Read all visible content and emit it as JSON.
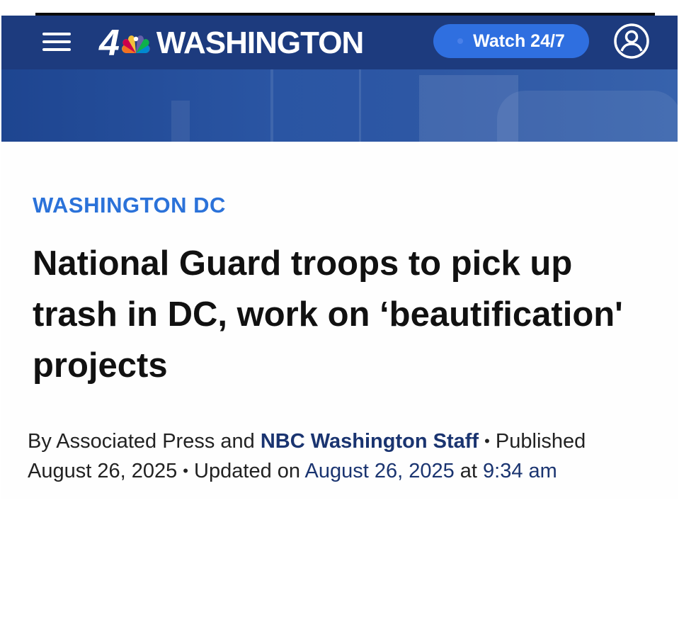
{
  "header": {
    "logo_number": "4",
    "logo_word": "WASHINGTON",
    "watch_label": "Watch 24/7",
    "icons": [
      "menu-icon",
      "nbc-peacock-icon",
      "account-icon"
    ],
    "colors": {
      "navbar": "#1d3b7e",
      "watch_button": "#2f6fe0"
    }
  },
  "article": {
    "section": "WASHINGTON DC",
    "headline": "National Guard troops to pick up trash in DC, work on ‘beautification' projects",
    "byline_prefix": "By Associated Press and ",
    "byline_staff": "NBC Washington Staff",
    "bullet": "•",
    "published_label": " Published",
    "published_date": "August 26, 2025",
    "updated_label": " Updated on ",
    "updated_date": "August 26, 2025",
    "at_label": " at ",
    "updated_time": "9:34 am",
    "colors": {
      "section": "#2b72d9",
      "headline": "#111111",
      "link": "#1a3470"
    }
  }
}
